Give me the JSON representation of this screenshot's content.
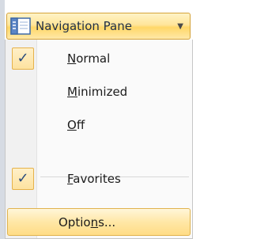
{
  "header": {
    "button_label": "Navigation Pane",
    "icon": "navigation-pane-icon",
    "dropdown_icon": "chevron-down-icon"
  },
  "menu": {
    "items": [
      {
        "label_pre": "",
        "mnemonic": "N",
        "label_post": "ormal",
        "checked": true
      },
      {
        "label_pre": "",
        "mnemonic": "M",
        "label_post": "inimized",
        "checked": false
      },
      {
        "label_pre": "",
        "mnemonic": "O",
        "label_post": "ff",
        "checked": false
      },
      {
        "label_pre": "",
        "mnemonic": "F",
        "label_post": "avorites",
        "checked": true
      }
    ],
    "options": {
      "label_pre": "Optio",
      "mnemonic": "n",
      "label_post": "s..."
    }
  },
  "colors": {
    "highlight_border": "#d5a33a",
    "highlight_fill": "#ffe59a",
    "check_color": "#2a4b7c",
    "text": "#1b1b1b"
  }
}
